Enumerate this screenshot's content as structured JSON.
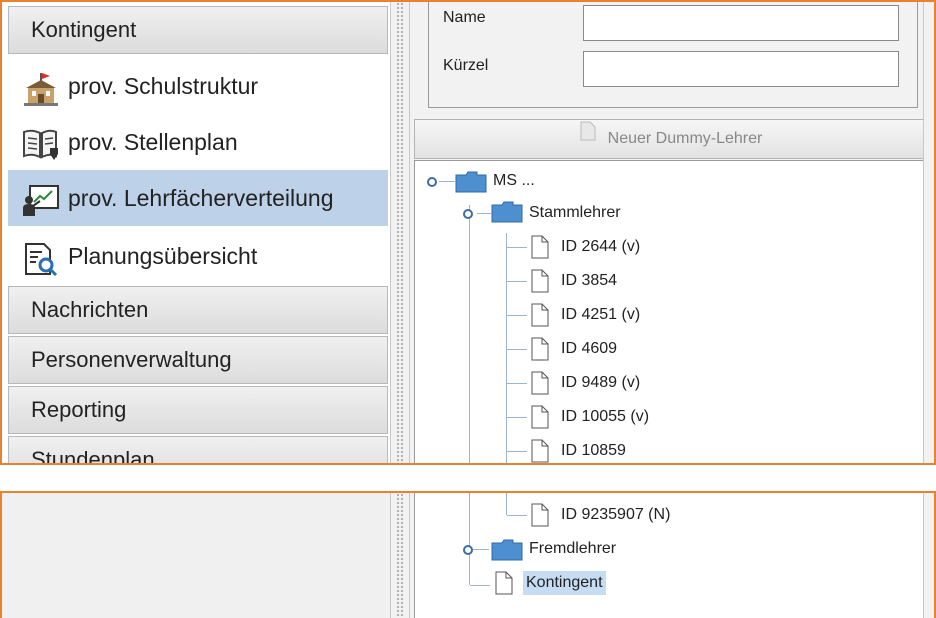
{
  "sidebar": {
    "sections": [
      {
        "label": "Kontingent"
      },
      {
        "label": "Nachrichten"
      },
      {
        "label": "Personenverwaltung"
      },
      {
        "label": "Reporting"
      },
      {
        "label": "Stundenplan"
      }
    ],
    "items": [
      {
        "label": "prov. Schulstruktur",
        "icon": "school-building-icon"
      },
      {
        "label": "prov. Stellenplan",
        "icon": "book-icon"
      },
      {
        "label": "prov. Lehrfächerverteilung",
        "icon": "teacher-board-icon",
        "selected": true
      },
      {
        "label": "Planungsübersicht",
        "icon": "document-search-icon"
      }
    ]
  },
  "form": {
    "name_label": "Name",
    "name_value": "",
    "kuerzel_label": "Kürzel",
    "kuerzel_value": ""
  },
  "toolbar": {
    "new_dummy_label": "Neuer Dummy-Lehrer"
  },
  "tree": {
    "root": {
      "label": "MS ..."
    },
    "stammlehrer": {
      "label": "Stammlehrer"
    },
    "teachers": [
      "ID 2644 (v)",
      "ID 3854",
      "ID 4251 (v)",
      "ID 4609",
      "ID 9489 (v)",
      "ID 10055 (v)",
      "ID 10859"
    ],
    "tail_teacher": "ID 9235907 (N)",
    "fremdlehrer": {
      "label": "Fremdlehrer"
    },
    "kontingent": {
      "label": "Kontingent",
      "selected": true
    }
  },
  "colors": {
    "accent_border": "#e8822e",
    "selection": "#bdd1e9",
    "folder": "#4d8fcf"
  }
}
